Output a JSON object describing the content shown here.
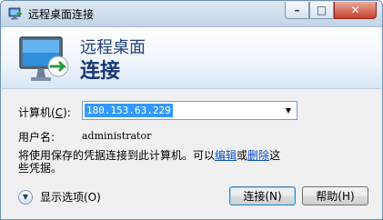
{
  "window": {
    "title": "远程桌面连接",
    "controls": {
      "minimize": "–",
      "maximize": "□",
      "close": "✕"
    }
  },
  "banner": {
    "line1": "远程桌面",
    "line2": "连接"
  },
  "form": {
    "computer_label_prefix": "计算机(",
    "computer_label_key": "C",
    "computer_label_suffix": "):",
    "computer_value": "180.153.63.229",
    "username_label": "用户名:",
    "username_value": "administrator",
    "info_part1": "将使用保存的凭据连接到此计算机。可以",
    "info_edit_link": "编辑",
    "info_or": "或",
    "info_delete_link": "删除",
    "info_part2": "这些凭据。"
  },
  "footer": {
    "show_options": "显示选项(O)",
    "connect_button": "连接(N)",
    "help_button": "帮助(H)"
  },
  "icons": {
    "app": "remote-desktop-icon",
    "banner": "monitor-icon",
    "options": "chevron-down-icon",
    "combo": "dropdown-arrow-icon"
  },
  "colors": {
    "banner_text": "#1e3f78",
    "selection": "#3399ff",
    "link": "#0b4fc4"
  }
}
